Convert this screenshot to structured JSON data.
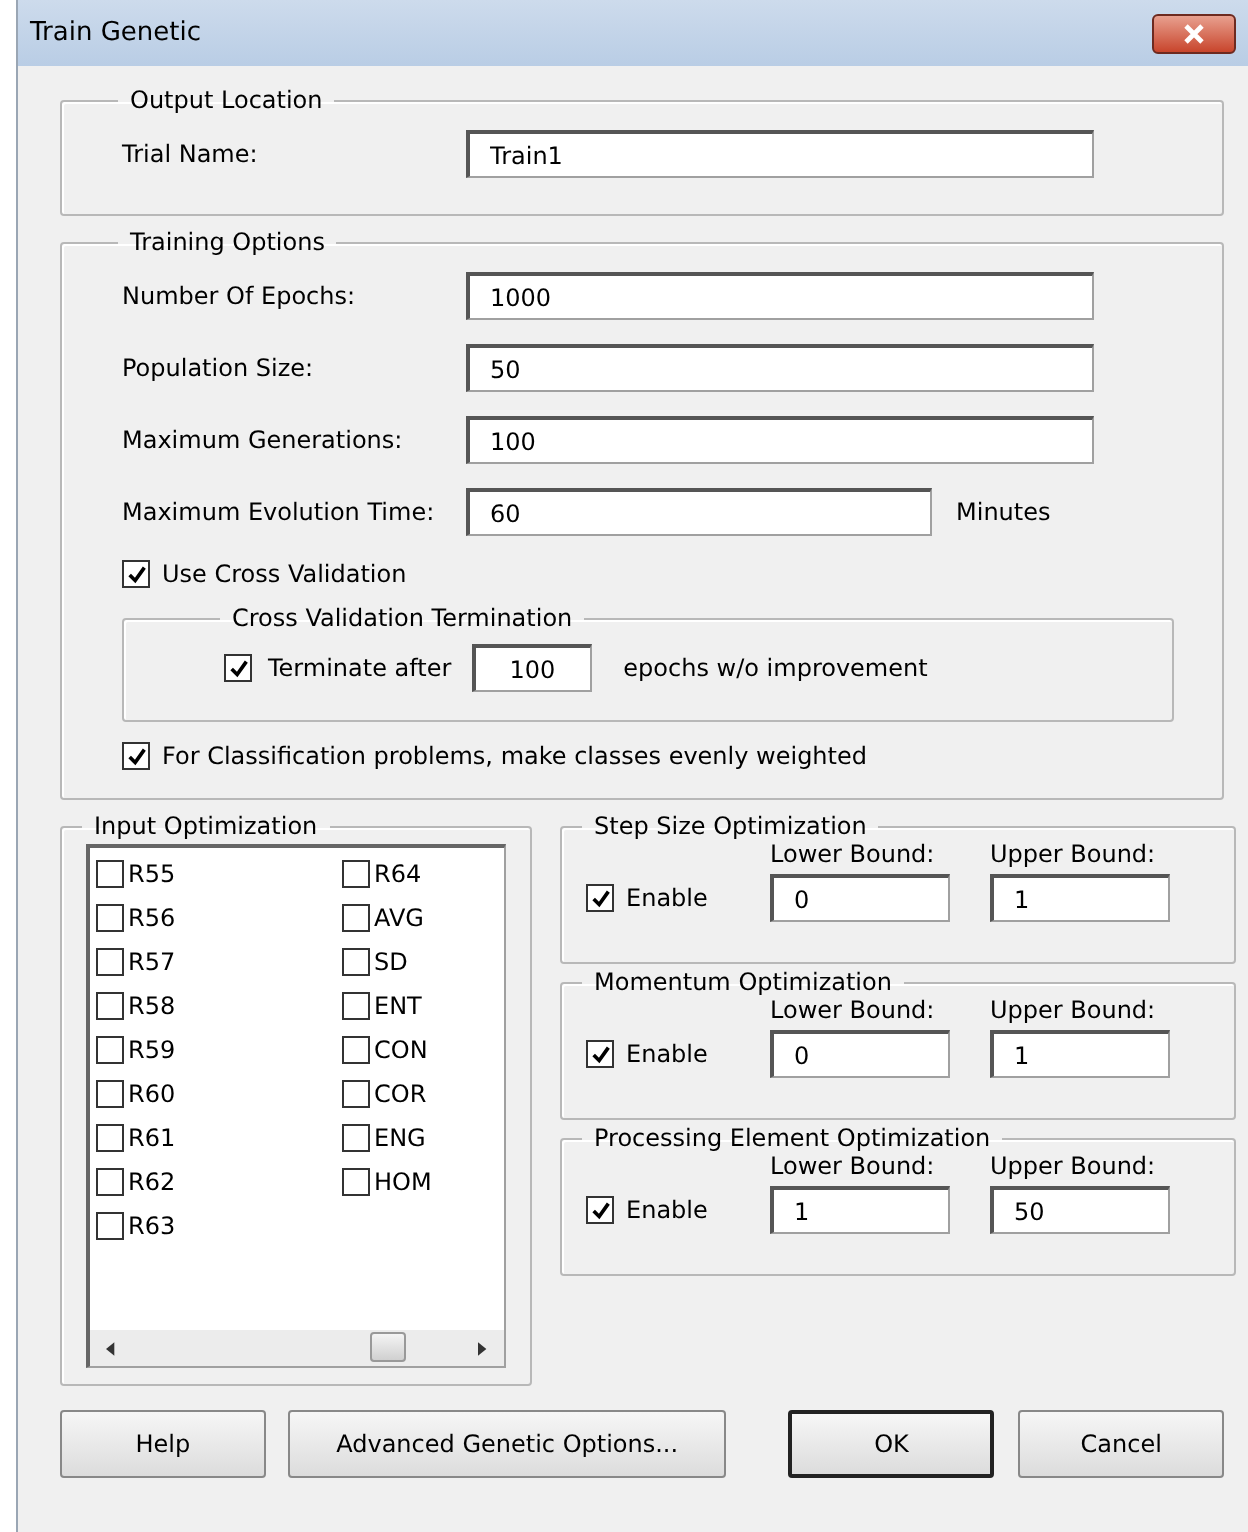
{
  "window": {
    "title": "Train Genetic"
  },
  "output_location": {
    "title": "Output Location",
    "field": {
      "label": "Trial Name:",
      "value": "Train1"
    }
  },
  "training_options": {
    "title": "Training Options",
    "fields": [
      {
        "label": "Number Of Epochs:",
        "value": "1000"
      },
      {
        "label": "Population Size:",
        "value": "50"
      },
      {
        "label": "Maximum Generations:",
        "value": "100"
      },
      {
        "label": "Maximum Evolution Time:",
        "value": "60",
        "unit": "Minutes"
      }
    ],
    "use_cross_validation": {
      "label": "Use Cross Validation",
      "checked": true
    },
    "termination": {
      "title": "Cross Validation Termination",
      "checked": true,
      "label": "Terminate after",
      "value": "100",
      "suffix": "epochs w/o improvement"
    },
    "even_weights": {
      "label": "For Classification problems, make classes evenly weighted",
      "checked": true
    }
  },
  "input_optimization": {
    "title": "Input Optimization",
    "items": [
      {
        "label": "R55",
        "checked": false
      },
      {
        "label": "R56",
        "checked": false
      },
      {
        "label": "R57",
        "checked": false
      },
      {
        "label": "R58",
        "checked": false
      },
      {
        "label": "R59",
        "checked": false
      },
      {
        "label": "R60",
        "checked": false
      },
      {
        "label": "R61",
        "checked": false
      },
      {
        "label": "R62",
        "checked": false
      },
      {
        "label": "R63",
        "checked": false
      },
      {
        "label": "R64",
        "checked": false
      },
      {
        "label": "AVG",
        "checked": false
      },
      {
        "label": "SD",
        "checked": false
      },
      {
        "label": "ENT",
        "checked": false
      },
      {
        "label": "CON",
        "checked": false
      },
      {
        "label": "COR",
        "checked": false
      },
      {
        "label": "ENG",
        "checked": false
      },
      {
        "label": "HOM",
        "checked": false
      }
    ]
  },
  "optimizations": [
    {
      "title": "Step Size Optimization",
      "enable": {
        "label": "Enable",
        "checked": true
      },
      "lower": {
        "label": "Lower Bound:",
        "value": "0"
      },
      "upper": {
        "label": "Upper Bound:",
        "value": "1"
      }
    },
    {
      "title": "Momentum Optimization",
      "enable": {
        "label": "Enable",
        "checked": true
      },
      "lower": {
        "label": "Lower Bound:",
        "value": "0"
      },
      "upper": {
        "label": "Upper Bound:",
        "value": "1"
      }
    },
    {
      "title": "Processing Element Optimization",
      "enable": {
        "label": "Enable",
        "checked": true
      },
      "lower": {
        "label": "Lower Bound:",
        "value": "1"
      },
      "upper": {
        "label": "Upper Bound:",
        "value": "50"
      }
    }
  ],
  "buttons": [
    {
      "label": "Help",
      "default": false
    },
    {
      "label": "Advanced Genetic Options...",
      "default": false
    },
    {
      "label": "OK",
      "default": true
    },
    {
      "label": "Cancel",
      "default": false
    }
  ]
}
